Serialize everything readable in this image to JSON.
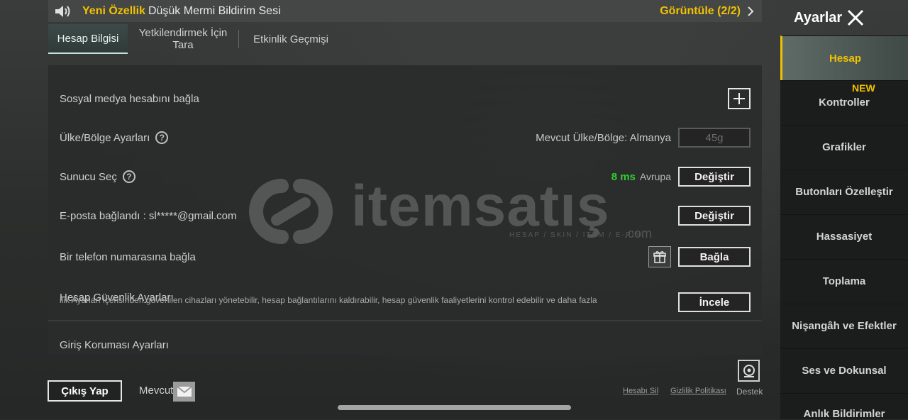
{
  "notice": {
    "new_label": "Yeni Özellik",
    "text": "Düşük Mermi Bildirim Sesi",
    "view_label": "Görüntüle (2/2)"
  },
  "tabs": [
    {
      "label": "Hesap Bilgisi",
      "active": true
    },
    {
      "label": "Yetkilendirmek İçin Tara",
      "active": false
    },
    {
      "label": "Etkinlik Geçmişi",
      "active": false
    }
  ],
  "rows": {
    "social": {
      "label": "Sosyal medya hesabını bağla"
    },
    "country": {
      "label": "Ülke/Bölge Ayarları",
      "current": "Mevcut Ülke/Bölge: Almanya",
      "button": "45g"
    },
    "server": {
      "label": "Sunucu Seç",
      "ping": "8 ms",
      "region": "Avrupa",
      "button": "Değiştir"
    },
    "email": {
      "label": "E-posta bağlandı : sl*****@gmail.com",
      "button": "Değiştir"
    },
    "phone": {
      "label": "Bir telefon numarasına bağla",
      "button": "Bağla"
    },
    "security": {
      "label": "Hesap Güvenlik Ayarları",
      "sub": "ilik Ayarları içerisinden güvenilen cihazları yönetebilir, hesap bağlantılarını kaldırabilir, hesap güvenlik faaliyetlerini kontrol edebilir ve daha fazla",
      "button": "İncele"
    },
    "login_protection": {
      "label": "Giriş Koruması Ayarları"
    }
  },
  "watermark": {
    "word": "itemsatış",
    "tag": "HESAP / SKIN / ITEM / E-PIN",
    "com": ".com"
  },
  "bottom": {
    "logout": "Çıkış Yap",
    "mevcut": "Mevcut",
    "delete_account": "Hesabı Sil",
    "privacy": "Gizlilik Politikası",
    "support": "Destek"
  },
  "sidebar": {
    "title": "Ayarlar",
    "new_badge": "NEW",
    "items": [
      {
        "label": "Hesap",
        "active": true
      },
      {
        "label": "Kontroller"
      },
      {
        "label": "Grafikler"
      },
      {
        "label": "Butonları Özelleştir"
      },
      {
        "label": "Hassasiyet"
      },
      {
        "label": "Toplama"
      },
      {
        "label": "Nişangâh ve Efektler"
      },
      {
        "label": "Ses ve Dokunsal"
      },
      {
        "label": "Anlık Bildirimler"
      }
    ]
  },
  "colors": {
    "accent": "#f2c200",
    "ping": "#33cc33"
  }
}
